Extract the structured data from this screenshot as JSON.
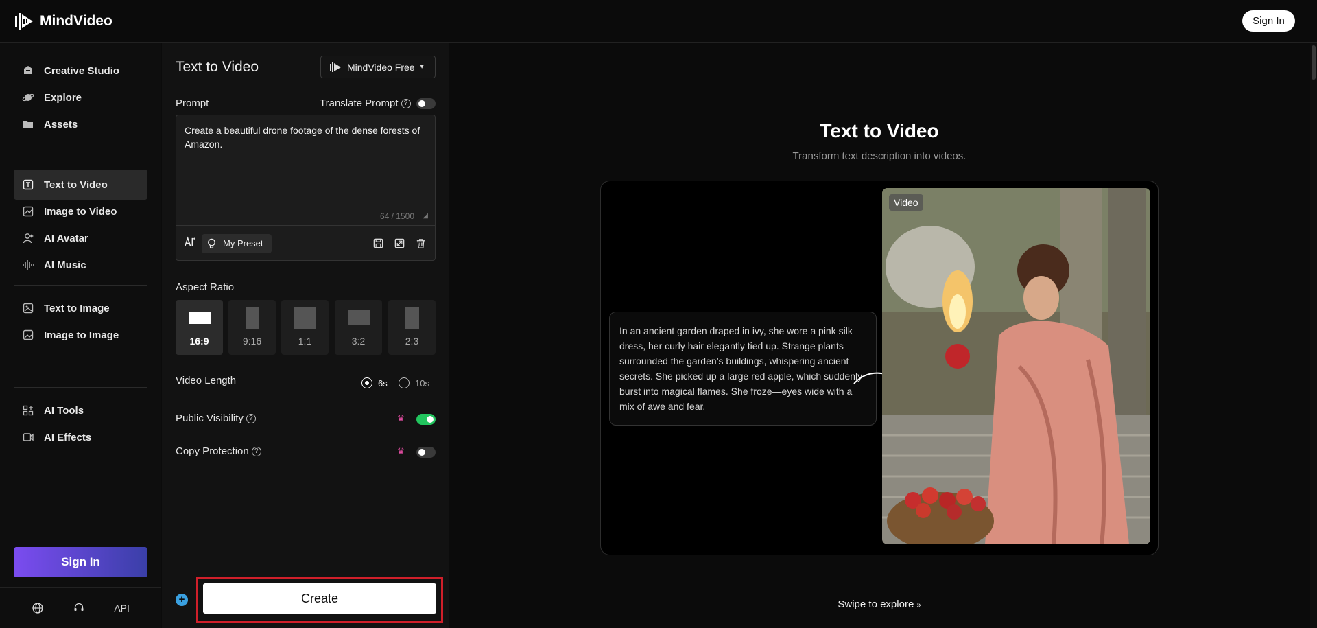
{
  "app": {
    "name": "MindVideo",
    "signin_label": "Sign In"
  },
  "sidebar": {
    "items": [
      {
        "label": "Creative Studio",
        "icon": "studio-icon"
      },
      {
        "label": "Explore",
        "icon": "planet-icon"
      },
      {
        "label": "Assets",
        "icon": "folder-icon"
      },
      {
        "label": "Text to Video",
        "icon": "text-video-icon",
        "active": true
      },
      {
        "label": "Image to Video",
        "icon": "image-video-icon"
      },
      {
        "label": "AI Avatar",
        "icon": "avatar-icon"
      },
      {
        "label": "AI Music",
        "icon": "music-icon"
      },
      {
        "label": "Text to Image",
        "icon": "text-image-icon"
      },
      {
        "label": "Image to Image",
        "icon": "image-image-icon"
      },
      {
        "label": "AI Tools",
        "icon": "tools-icon"
      },
      {
        "label": "AI Effects",
        "icon": "effects-icon"
      }
    ],
    "signin_label": "Sign In",
    "bottom": {
      "api_label": "API",
      "icons": [
        "globe-icon",
        "support-icon"
      ]
    }
  },
  "panel": {
    "title": "Text to Video",
    "model": "MindVideo Free",
    "prompt_label": "Prompt",
    "translate_label": "Translate Prompt",
    "translate_on": false,
    "prompt_value": "Create a beautiful drone footage of the dense forests of Amazon.",
    "prompt_count": "64 / 1500",
    "preset_label": "My Preset",
    "aspect_label": "Aspect Ratio",
    "aspect_ratios": [
      "16:9",
      "9:16",
      "1:1",
      "3:2",
      "2:3"
    ],
    "aspect_selected": "16:9",
    "length_label": "Video Length",
    "length_options": [
      "6s",
      "10s"
    ],
    "length_selected": "6s",
    "visibility_label": "Public Visibility",
    "visibility_on": true,
    "copy_label": "Copy Protection",
    "copy_on": false,
    "create_label": "Create"
  },
  "main": {
    "title": "Text to Video",
    "subtitle": "Transform text description into videos.",
    "example_text": "In an ancient garden draped in ivy, she wore a pink silk dress, her curly hair elegantly tied up. Strange plants surrounded the garden’s buildings, whispering ancient secrets. She picked up a large red apple, which suddenly burst into magical flames. She froze—eyes wide with a mix of awe and fear.",
    "video_tag": "Video",
    "swipe_label": "Swipe to explore"
  },
  "colors": {
    "accent_green": "#22c55e",
    "signin_gradient_start": "#7b4cf0",
    "signin_gradient_end": "#3a3fa8",
    "highlight_red": "#d01f2a"
  }
}
